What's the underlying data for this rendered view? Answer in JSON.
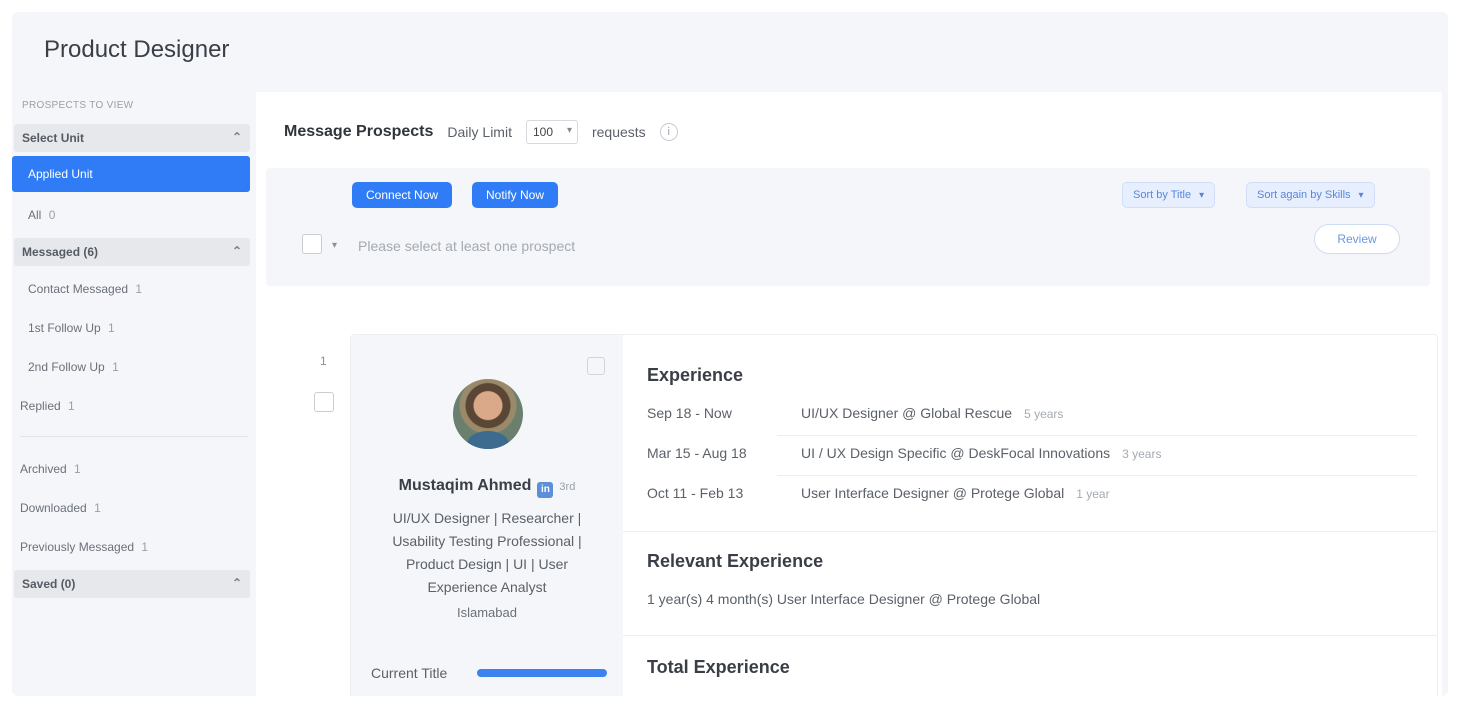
{
  "page": {
    "title": "Product Designer"
  },
  "sidebar": {
    "caption": "PROSPECTS TO VIEW",
    "select_group": "Select Unit",
    "active_item": "Applied Unit",
    "item_all": "All",
    "messaged_group": "Messaged (6)",
    "messaged_items": [
      {
        "label": "Contact Messaged",
        "count": "1"
      },
      {
        "label": "1st Follow Up",
        "count": "1"
      },
      {
        "label": "2nd Follow Up",
        "count": "1"
      }
    ],
    "replied": {
      "label": "Replied",
      "count": "1"
    },
    "archived": {
      "label": "Archived",
      "count": "1"
    },
    "downloaded": {
      "label": "Downloaded",
      "count": "1"
    },
    "previously": {
      "label": "Previously Messaged",
      "count": "1"
    },
    "saved_group": "Saved (0)"
  },
  "toolbar": {
    "title": "Message Prospects",
    "daily_limit_label": "Daily Limit",
    "daily_limit_value": "100",
    "requests_label": "requests",
    "info_glyph": "i"
  },
  "actions": {
    "chip_1": "Connect Now",
    "chip_2": "Notify Now",
    "filter_1": "Sort by Title",
    "filter_2": "Sort again by Skills",
    "hint": "Please select at least one prospect",
    "review_button": "Review"
  },
  "prospect": {
    "index": "1",
    "name": "Mustaqim Ahmed",
    "degree": "3rd",
    "headline": "UI/UX Designer | Researcher | Usability Testing Professional | Product Design | UI | User Experience Analyst",
    "location": "Islamabad",
    "meter_label": "Current Title",
    "experience_title": "Experience",
    "experience": [
      {
        "dates": "Sep 18 - Now",
        "role": "UI/UX Designer @ Global Rescue",
        "tenure": "5 years"
      },
      {
        "dates": "Mar 15 - Aug 18",
        "role": "UI / UX Design Specific @ DeskFocal Innovations",
        "tenure": "3 years"
      },
      {
        "dates": "Oct 11 - Feb 13",
        "role": "User Interface Designer @ Protege Global",
        "tenure": "1 year"
      }
    ],
    "relevant_title": "Relevant Experience",
    "relevant_text": "1 year(s) 4 month(s) User Interface Designer @ Protege Global",
    "total_title": "Total Experience"
  }
}
